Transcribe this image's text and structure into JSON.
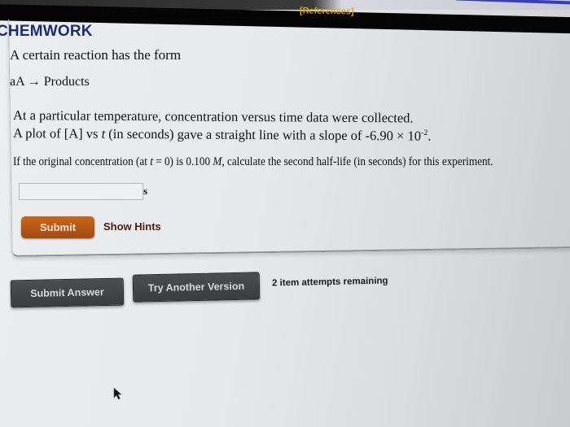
{
  "header": {
    "references_link": "[References]",
    "brand": "CHEMWORK"
  },
  "question": {
    "intro": "A certain reaction has the form",
    "reaction": "aA → Products",
    "line1": "At a particular temperature, concentration versus time data were collected.",
    "line2_prefix": "A plot of [A] vs ",
    "line2_var": "t",
    "line2_mid": " (in seconds) gave a straight line with a slope of -6.90 × 10",
    "line2_exp": "-2",
    "line2_end": ".",
    "line3_a": "If the original concentration (at ",
    "line3_var": "t",
    "line3_b": " = 0) is 0.100 ",
    "line3_unit": "M",
    "line3_c": ", calculate the second half-life (in seconds) for this experiment."
  },
  "answer": {
    "value": "",
    "placeholder": "",
    "unit": "s"
  },
  "buttons": {
    "submit": "Submit",
    "show_hints": "Show Hints",
    "submit_answer": "Submit Answer",
    "try_another": "Try Another Version"
  },
  "status": {
    "attempts": "2 item attempts remaining"
  },
  "colors": {
    "brand": "#1c2d6e",
    "references": "#d9a520",
    "submit_button": "#b5561a",
    "dark_button": "#424446"
  }
}
